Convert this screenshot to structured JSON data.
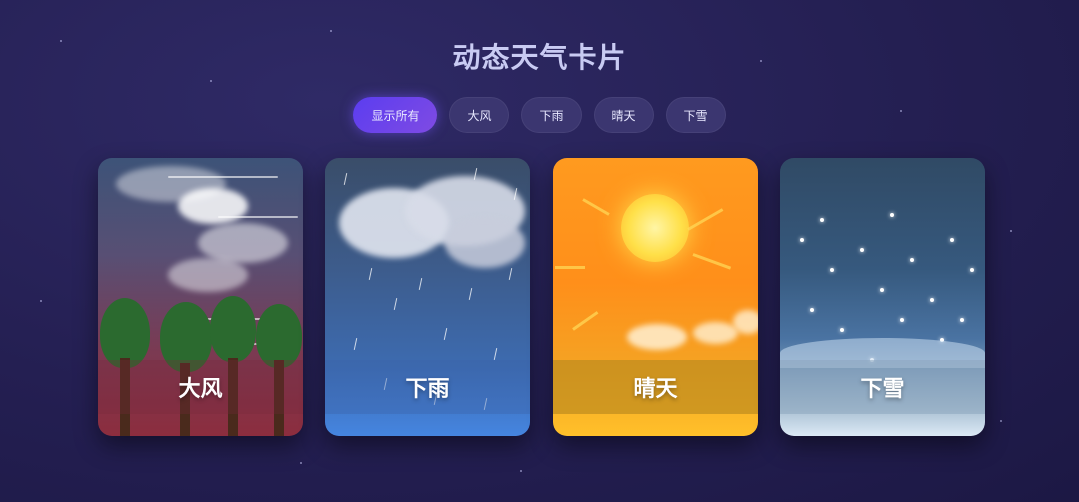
{
  "page": {
    "title": "动态天气卡片"
  },
  "filters": [
    {
      "label": "显示所有",
      "active": true
    },
    {
      "label": "大风",
      "active": false
    },
    {
      "label": "下雨",
      "active": false
    },
    {
      "label": "晴天",
      "active": false
    },
    {
      "label": "下雪",
      "active": false
    }
  ],
  "cards": [
    {
      "label": "大风",
      "theme": "wind"
    },
    {
      "label": "下雨",
      "theme": "rain"
    },
    {
      "label": "晴天",
      "theme": "sun"
    },
    {
      "label": "下雪",
      "theme": "snow"
    }
  ],
  "colors": {
    "accent": "#6a44ef",
    "background": "#241f52"
  }
}
